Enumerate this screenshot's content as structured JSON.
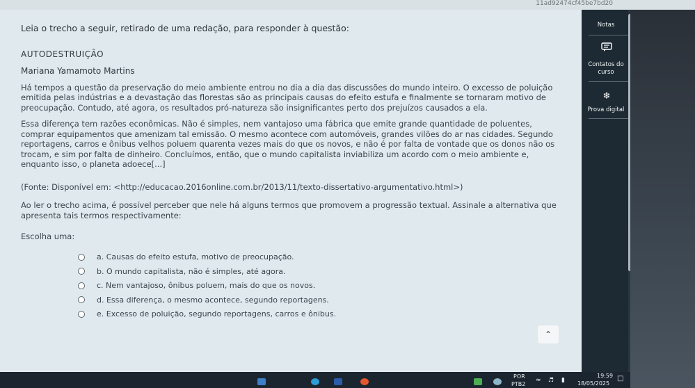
{
  "window": {
    "hash_id": "11ad92474cf45be7bd20"
  },
  "question": {
    "instruction": "Leia o trecho a seguir, retirado de uma redação, para responder à questão:",
    "essay_title": "AUTODESTRUIÇÃO",
    "essay_author": "Mariana Yamamoto Martins",
    "paragraphs": [
      "Há tempos a questão da preservação do meio ambiente entrou no dia a dia das discussões do mundo inteiro. O excesso de poluição emitida pelas indústrias e a devastação das florestas são as principais causas do efeito estufa e finalmente se tornaram motivo de preocupação. Contudo, até agora, os resultados pró-natureza são insignificantes perto dos prejuízos causados a ela.",
      "Essa diferença tem razões econômicas. Não é simples, nem vantajoso uma fábrica que emite grande quantidade de poluentes, comprar equipamentos que amenizam tal emissão. O mesmo acontece com automóveis, grandes vilões do ar nas cidades. Segundo reportagens, carros e ônibus velhos poluem quarenta vezes mais do que os novos, e não é por falta de vontade que os donos não os trocam, e sim por falta de dinheiro. Concluímos, então, que o mundo capitalista inviabiliza um acordo com o meio ambiente e, enquanto isso, o planeta adoece[...]"
    ],
    "source": "(Fonte: Disponível em: <http://educacao.2016online.com.br/2013/11/texto-dissertativo-argumentativo.html>)",
    "prompt": "Ao ler o trecho acima, é possível perceber que nele há alguns termos que promovem a progressão textual. Assinale a alternativa que apresenta tais termos respectivamente:",
    "choose_label": "Escolha uma:",
    "options": [
      {
        "label": "a. Causas do efeito estufa, motivo de preocupação."
      },
      {
        "label": "b. O mundo capitalista, não é simples, até agora."
      },
      {
        "label": "c. Nem vantajoso, ônibus poluem, mais do que os novos."
      },
      {
        "label": "d. Essa diferença, o mesmo acontece, segundo reportagens."
      },
      {
        "label": "e. Excesso de poluição, segundo reportagens, carros e ônibus."
      }
    ]
  },
  "sidebar": {
    "items": [
      {
        "label": "Notas",
        "icon": "none"
      },
      {
        "label": "Contatos do curso",
        "icon": "chat-icon"
      },
      {
        "label": "Prova digital",
        "icon": "snowflake-icon"
      }
    ]
  },
  "taskbar": {
    "language": "POR",
    "keyboard": "PTB2",
    "time": "19:59",
    "date": "18/05/2025"
  },
  "colors": {
    "content_bg": "#dfe9ee",
    "sidebar_bg": "#1e2a33",
    "taskbar_bg": "#1b2530"
  }
}
